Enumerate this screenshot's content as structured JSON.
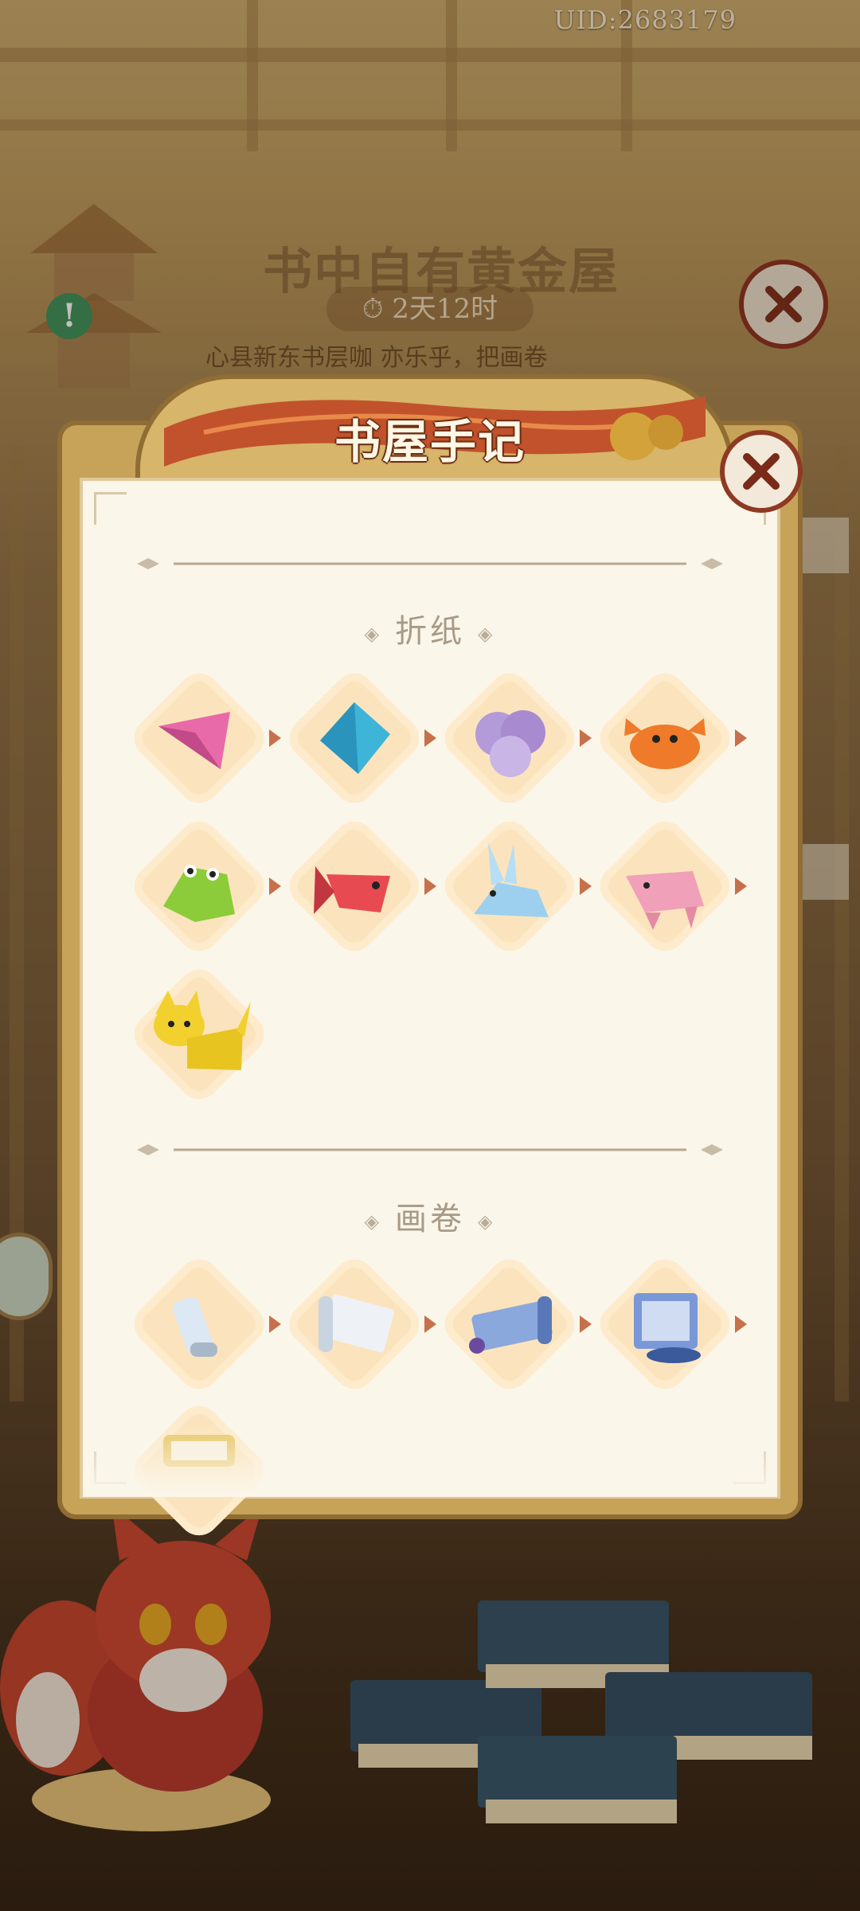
{
  "header": {
    "uid": "UID:2683179"
  },
  "background_event": {
    "title": "书中自有黄金屋",
    "timer": "2天12时",
    "description": "心县新东书层咖 亦乐乎，把画卷"
  },
  "modal": {
    "title": "书屋手记",
    "sections": [
      {
        "title": "折纸",
        "items": [
          {
            "name": "pink-triangle",
            "color": "#e86aa8"
          },
          {
            "name": "blue-diamond",
            "color": "#3eb4d8"
          },
          {
            "name": "purple-fortune-teller",
            "color": "#a88ad0"
          },
          {
            "name": "orange-crab",
            "color": "#ee7a2a"
          },
          {
            "name": "green-frog",
            "color": "#8ccc3a"
          },
          {
            "name": "red-fish",
            "color": "#e84a52"
          },
          {
            "name": "blue-rabbit",
            "color": "#9cd0ee"
          },
          {
            "name": "pink-pig",
            "color": "#f0a0b8"
          },
          {
            "name": "yellow-cat",
            "color": "#f2d02e"
          }
        ]
      },
      {
        "title": "画卷",
        "items": [
          {
            "name": "small-scroll",
            "color": "#dce8f4"
          },
          {
            "name": "open-scroll",
            "color": "#eef2f6"
          },
          {
            "name": "blue-scroll",
            "color": "#8aa8dc"
          },
          {
            "name": "ornate-scroll",
            "color": "#7a98d8"
          },
          {
            "name": "gold-scroll",
            "color": "#e8c86a"
          }
        ]
      }
    ]
  },
  "colors": {
    "accent": "#8e3a22",
    "paper": "#fbf6ea",
    "tile": "#fbe4bd",
    "arrow": "#c7704c"
  }
}
